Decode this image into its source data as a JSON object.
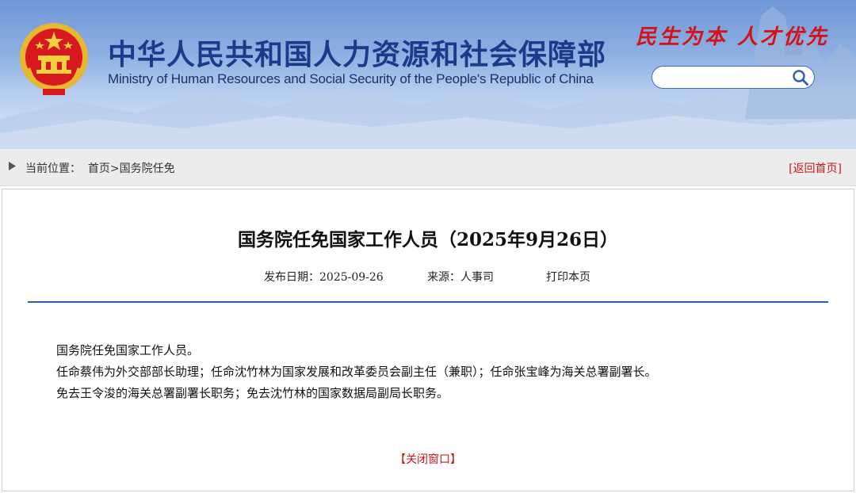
{
  "header": {
    "title_cn": "中华人民共和国人力资源和社会保障部",
    "title_en": "Ministry of Human Resources and Social Security of the People's Republic of China",
    "slogan": "民生为本 人才优先",
    "search": {
      "value": "",
      "placeholder": ""
    }
  },
  "breadcrumb": {
    "label": "当前位置：",
    "home": "首页",
    "separator": ">",
    "current": "国务院任免",
    "back_home": "[返回首页]"
  },
  "article": {
    "title": "国务院任免国家工作人员（2025年9月26日）",
    "date_label": "发布日期：",
    "date": "2025-09-26",
    "source_label": "来源：",
    "source": "人事司",
    "print": "打印本页",
    "paragraphs": [
      "国务院任免国家工作人员。",
      "任命蔡伟为外交部部长助理；任命沈竹林为国家发展和改革委员会副主任（兼职）；任命张宝峰为海关总署副署长。",
      "免去王令浚的海关总署副署长职务；免去沈竹林的国家数据局副局长职务。"
    ],
    "close": "【关闭窗口】"
  },
  "colors": {
    "brand_blue": "#1d3a8a",
    "accent_red": "#c8161d",
    "rule_blue": "#2f5da8"
  },
  "icons": {
    "emblem": "national-emblem-icon",
    "search": "search-icon",
    "breadcrumb_arrow": "triangle-right-icon"
  }
}
